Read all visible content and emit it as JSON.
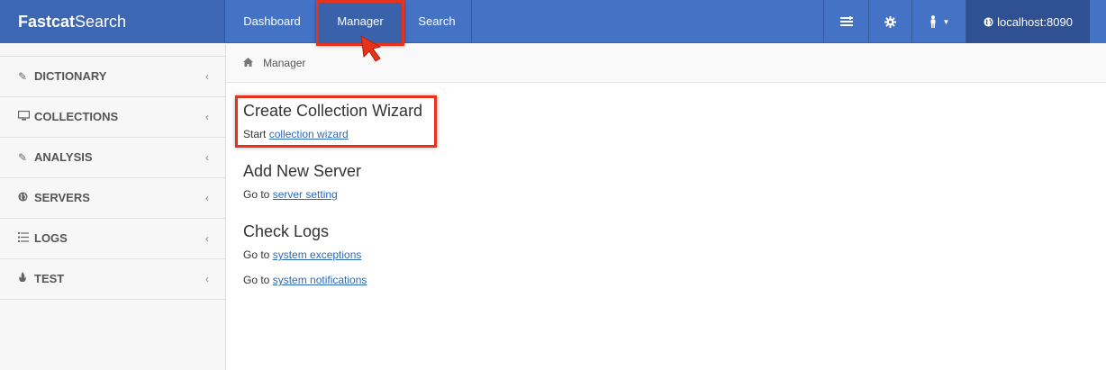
{
  "navbar": {
    "brand_bold": "Fastcat",
    "brand_rest": "Search",
    "items": [
      {
        "label": "Dashboard"
      },
      {
        "label": "Manager",
        "active": true
      },
      {
        "label": "Search"
      }
    ],
    "host_label": "localhost:8090",
    "colors": {
      "bar": "#4472c4",
      "active": "#3a62ab",
      "host_bg": "#2f5193",
      "highlight": "#e8321c"
    }
  },
  "sidebar": {
    "items": [
      {
        "label": "DICTIONARY",
        "icon": "edit-icon"
      },
      {
        "label": "COLLECTIONS",
        "icon": "monitor-icon"
      },
      {
        "label": "ANALYSIS",
        "icon": "edit-icon"
      },
      {
        "label": "SERVERS",
        "icon": "globe-icon"
      },
      {
        "label": "LOGS",
        "icon": "list-icon"
      },
      {
        "label": "TEST",
        "icon": "fire-icon"
      }
    ]
  },
  "breadcrumb": {
    "label": "Manager"
  },
  "main": {
    "sections": [
      {
        "title": "Create Collection Wizard",
        "lines": [
          {
            "prefix": "Start ",
            "link": "collection wizard"
          }
        ]
      },
      {
        "title": "Add New Server",
        "lines": [
          {
            "prefix": "Go to ",
            "link": "server setting"
          }
        ]
      },
      {
        "title": "Check Logs",
        "lines": [
          {
            "prefix": "Go to ",
            "link": "system exceptions"
          },
          {
            "prefix": "Go to ",
            "link": "system notifications"
          }
        ]
      }
    ]
  }
}
